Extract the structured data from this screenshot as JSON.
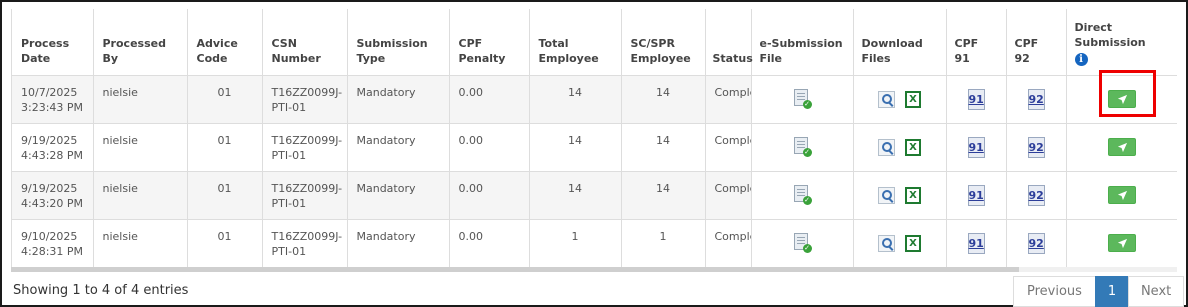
{
  "table": {
    "headers": {
      "process_date": "Process Date",
      "processed_by": "Processed By",
      "advice_code": "Advice Code",
      "csn_number": "CSN Number",
      "submission_type": "Submission Type",
      "cpf_penalty": "CPF Penalty",
      "total_employee": "Total Employee",
      "sc_spr_employee": "SC/SPR Employee",
      "status": "Status",
      "e_submission_file": "e-Submission File",
      "download_files": "Download Files",
      "cpf91": "CPF 91",
      "cpf92": "CPF 92",
      "direct_submission": "Direct Submission"
    },
    "rows": [
      {
        "process_date": "10/7/2025 3:23:43 PM",
        "processed_by": "nielsie",
        "advice_code": "01",
        "csn_number": "T16ZZ0099J-PTI-01",
        "submission_type": "Mandatory",
        "cpf_penalty": "0.00",
        "total_employee": "14",
        "sc_spr_employee": "14",
        "status": "Complete",
        "cpf91_label": "91",
        "cpf92_label": "92"
      },
      {
        "process_date": "9/19/2025 4:43:28 PM",
        "processed_by": "nielsie",
        "advice_code": "01",
        "csn_number": "T16ZZ0099J-PTI-01",
        "submission_type": "Mandatory",
        "cpf_penalty": "0.00",
        "total_employee": "14",
        "sc_spr_employee": "14",
        "status": "Complete",
        "cpf91_label": "91",
        "cpf92_label": "92"
      },
      {
        "process_date": "9/19/2025 4:43:20 PM",
        "processed_by": "nielsie",
        "advice_code": "01",
        "csn_number": "T16ZZ0099J-PTI-01",
        "submission_type": "Mandatory",
        "cpf_penalty": "0.00",
        "total_employee": "14",
        "sc_spr_employee": "14",
        "status": "Complete",
        "cpf91_label": "91",
        "cpf92_label": "92"
      },
      {
        "process_date": "9/10/2025 4:28:31 PM",
        "processed_by": "nielsie",
        "advice_code": "01",
        "csn_number": "T16ZZ0099J-PTI-01",
        "submission_type": "Mandatory",
        "cpf_penalty": "0.00",
        "total_employee": "1",
        "sc_spr_employee": "1",
        "status": "Complete",
        "cpf91_label": "91",
        "cpf92_label": "92"
      }
    ],
    "icons": {
      "e_submission": "file-check-icon",
      "preview": "magnifier-icon",
      "excel": "excel-icon",
      "send": "paper-plane-icon",
      "info": "info-icon"
    }
  },
  "footer": {
    "entries_info": "Showing 1 to 4 of 4 entries",
    "pagination": {
      "previous": "Previous",
      "current_page": "1",
      "next": "Next"
    }
  },
  "colors": {
    "send_button": "#5cb85c",
    "highlight": "#ee0000",
    "page_active": "#337ab7",
    "cpf_link": "#2d3e9a"
  }
}
